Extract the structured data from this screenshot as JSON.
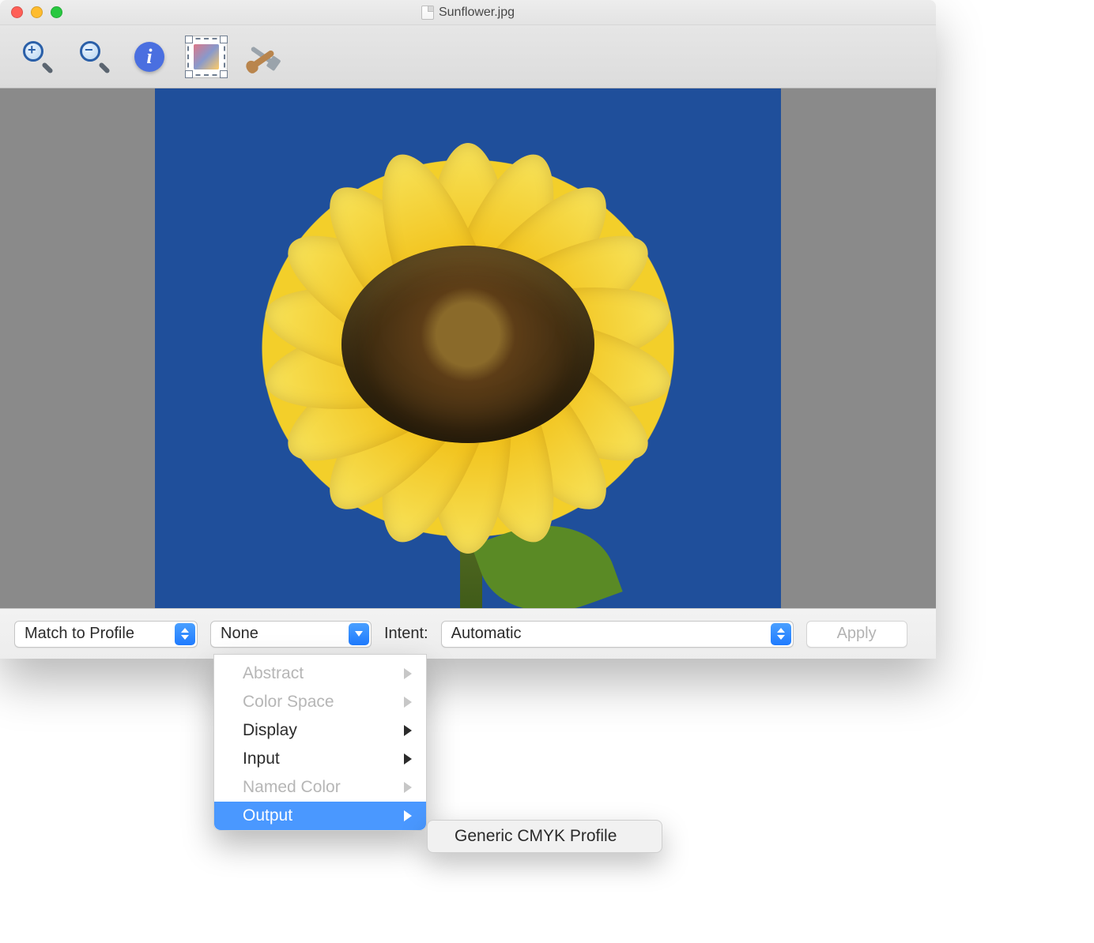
{
  "window": {
    "title": "Sunflower.jpg"
  },
  "toolbar": {
    "zoom_in": "zoom-in",
    "zoom_out": "zoom-out",
    "info": "info",
    "resize": "resize",
    "tools": "tools"
  },
  "controls": {
    "action_select": "Match to Profile",
    "profile_select": "None",
    "intent_label": "Intent:",
    "intent_select": "Automatic",
    "apply_label": "Apply"
  },
  "profile_menu": {
    "items": [
      {
        "label": "Abstract",
        "enabled": false,
        "submenu": true,
        "highlighted": false
      },
      {
        "label": "Color Space",
        "enabled": false,
        "submenu": true,
        "highlighted": false
      },
      {
        "label": "Display",
        "enabled": true,
        "submenu": true,
        "highlighted": false
      },
      {
        "label": "Input",
        "enabled": true,
        "submenu": true,
        "highlighted": false
      },
      {
        "label": "Named Color",
        "enabled": false,
        "submenu": true,
        "highlighted": false
      },
      {
        "label": "Output",
        "enabled": true,
        "submenu": true,
        "highlighted": true
      }
    ],
    "submenu_item": "Generic CMYK Profile"
  }
}
